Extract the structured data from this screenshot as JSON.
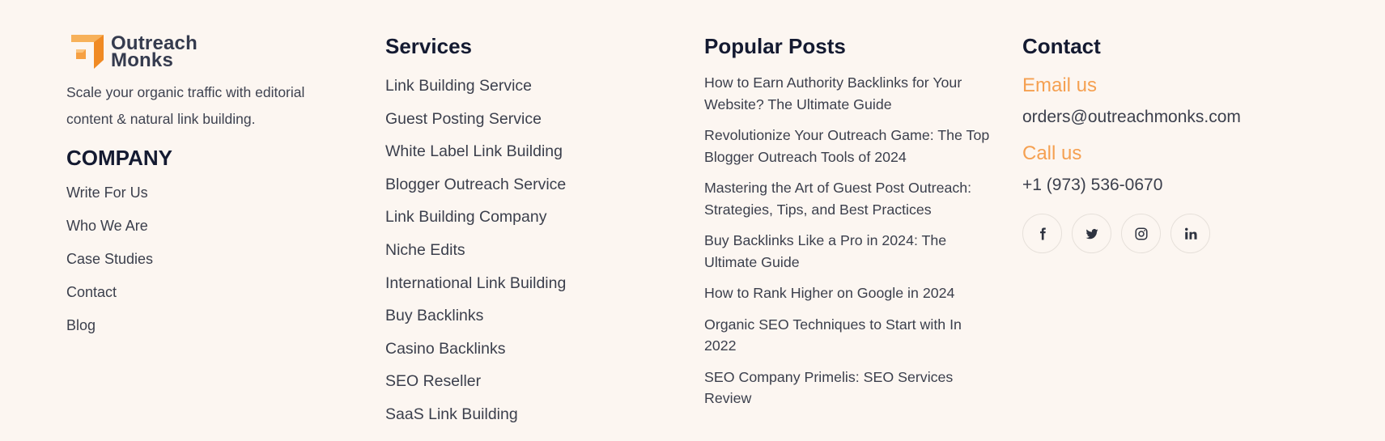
{
  "brand": {
    "name_line1": "Outreach",
    "name_line2": "Monks",
    "logo_colors": {
      "light": "#f7b15a",
      "dark": "#f08a24"
    },
    "tagline": "Scale your organic traffic with editorial content & natural link building."
  },
  "company": {
    "title": "COMPANY",
    "links": [
      "Write For Us",
      "Who We Are",
      "Case Studies",
      "Contact",
      "Blog"
    ]
  },
  "services": {
    "title": "Services",
    "links": [
      "Link Building Service",
      "Guest Posting Service",
      "White Label Link Building",
      "Blogger Outreach Service",
      "Link Building Company",
      "Niche Edits",
      "International Link Building",
      "Buy Backlinks",
      "Casino Backlinks",
      "SEO Reseller",
      "SaaS Link Building"
    ]
  },
  "posts": {
    "title": "Popular Posts",
    "links": [
      "How to Earn Authority Backlinks for Your Website? The Ultimate Guide",
      "Revolutionize Your Outreach Game: The Top Blogger Outreach Tools of 2024",
      "Mastering the Art of Guest Post Outreach: Strategies, Tips, and Best Practices",
      "Buy Backlinks Like a Pro in 2024: The Ultimate Guide",
      "How to Rank Higher on Google in 2024",
      "Organic SEO Techniques to Start with In 2022",
      "SEO Company Primelis: SEO Services Review"
    ]
  },
  "contact": {
    "title": "Contact",
    "email_label": "Email us",
    "email": "orders@outreachmonks.com",
    "phone_label": "Call us",
    "phone": "+1 (973) 536-0670",
    "accent_color": "#f5a051",
    "socials": [
      "facebook-icon",
      "twitter-icon",
      "instagram-icon",
      "linkedin-icon"
    ]
  }
}
